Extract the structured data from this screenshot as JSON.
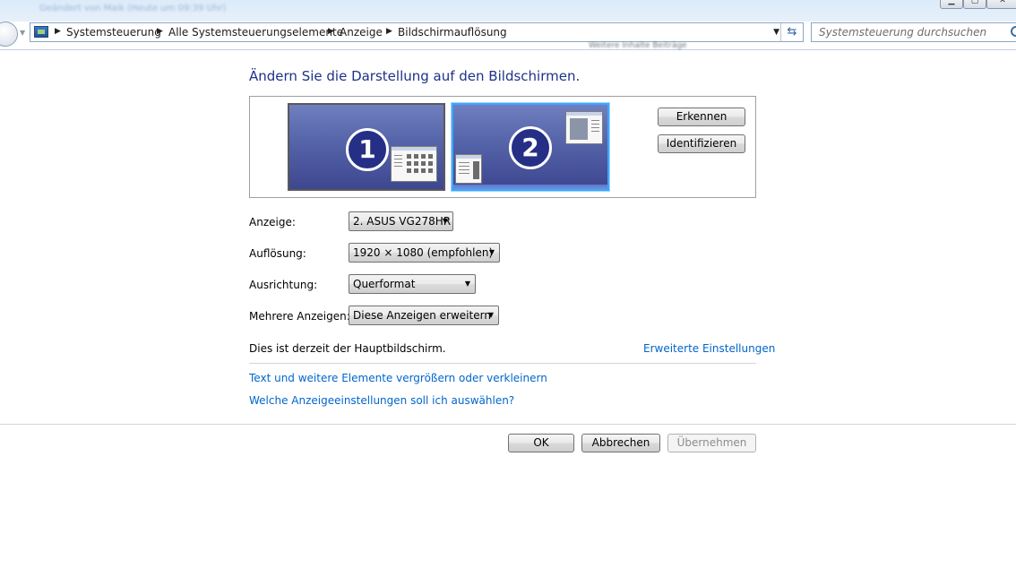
{
  "window": {
    "title_blurred": "Geändert von Maik (Heute um 09:39 Uhr)"
  },
  "navigation": {
    "breadcrumbs": [
      "Systemsteuerung",
      "Alle Systemsteuerungselemente",
      "Anzeige",
      "Bildschirmauflösung"
    ],
    "search_placeholder": "Systemsteuerung durchsuchen"
  },
  "background_blur_text": "Weitere Inhalte Beiträge",
  "main": {
    "heading": "Ändern Sie die Darstellung auf den Bildschirmen.",
    "monitors": [
      {
        "number": "1",
        "selected": false
      },
      {
        "number": "2",
        "selected": true
      }
    ],
    "detect_button": "Erkennen",
    "identify_button": "Identifizieren",
    "fields": {
      "display_label": "Anzeige:",
      "display_value": "2. ASUS VG278HR",
      "resolution_label": "Auflösung:",
      "resolution_value": "1920 × 1080 (empfohlen)",
      "orientation_label": "Ausrichtung:",
      "orientation_value": "Querformat",
      "multiple_label": "Mehrere Anzeigen:",
      "multiple_value": "Diese Anzeigen erweitern"
    },
    "status_text": "Dies ist derzeit der Hauptbildschirm.",
    "advanced_link": "Erweiterte Einstellungen",
    "link_text_size": "Text und weitere Elemente vergrößern oder verkleinern",
    "link_which_settings": "Welche Anzeigeeinstellungen soll ich auswählen?"
  },
  "footer": {
    "ok": "OK",
    "cancel": "Abbrechen",
    "apply": "Übernehmen"
  },
  "colors": {
    "heading": "#1e3287",
    "link": "#0066cc",
    "monitor_selected_border": "#3ba7ff",
    "monitor_number_bg": "#262f86"
  }
}
